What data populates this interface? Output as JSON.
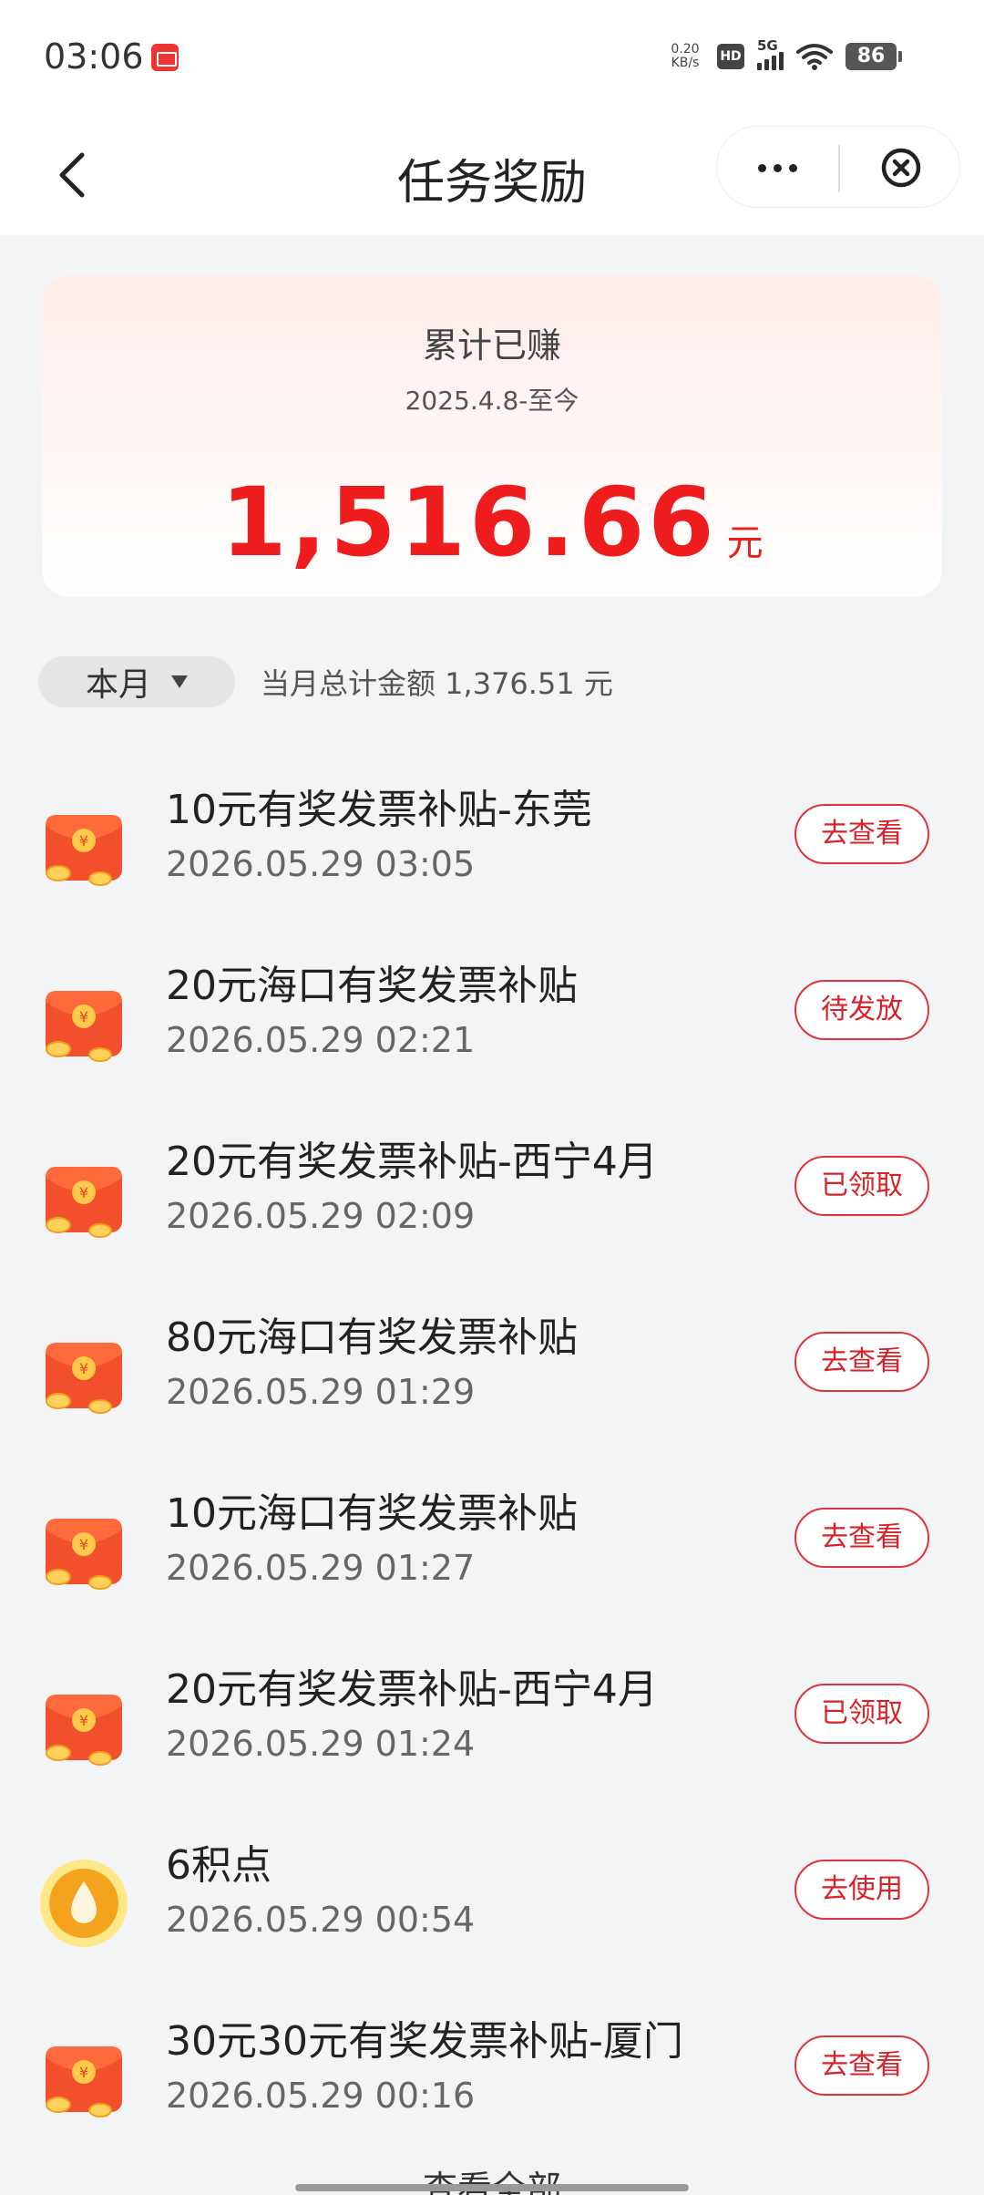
{
  "status_bar": {
    "time": "03:06",
    "net_speed_value": "0.20",
    "net_speed_unit": "KB/s",
    "hd_label": "HD",
    "signal_label": "5G",
    "battery": "86"
  },
  "nav": {
    "title": "任务奖励"
  },
  "summary": {
    "label": "累计已赚",
    "range": "2025.4.8-至今",
    "amount": "1,516.66",
    "unit": "元"
  },
  "filter": {
    "month_label": "本月",
    "month_total": "当月总计金额 1,376.51 元"
  },
  "rewards": [
    {
      "title": "10元有奖发票补贴-东莞",
      "time": "2026.05.29 03:05",
      "action": "去查看",
      "icon": "red-packet-icon"
    },
    {
      "title": "20元海口有奖发票补贴",
      "time": "2026.05.29 02:21",
      "action": "待发放",
      "icon": "red-packet-icon"
    },
    {
      "title": "20元有奖发票补贴-西宁4月",
      "time": "2026.05.29 02:09",
      "action": "已领取",
      "icon": "red-packet-icon"
    },
    {
      "title": "80元海口有奖发票补贴",
      "time": "2026.05.29 01:29",
      "action": "去查看",
      "icon": "red-packet-icon"
    },
    {
      "title": "10元海口有奖发票补贴",
      "time": "2026.05.29 01:27",
      "action": "去查看",
      "icon": "red-packet-icon"
    },
    {
      "title": "20元有奖发票补贴-西宁4月",
      "time": "2026.05.29 01:24",
      "action": "已领取",
      "icon": "red-packet-icon"
    },
    {
      "title": "6积点",
      "time": "2026.05.29 00:54",
      "action": "去使用",
      "icon": "points-coin-icon"
    },
    {
      "title": "30元30元有奖发票补贴-厦门",
      "time": "2026.05.29 00:16",
      "action": "去查看",
      "icon": "red-packet-icon"
    }
  ],
  "footer": {
    "view_all": "查看全部"
  },
  "colors": {
    "accent": "#ee1c1c",
    "button_border": "#e0333a",
    "background": "#f3f4f6"
  }
}
